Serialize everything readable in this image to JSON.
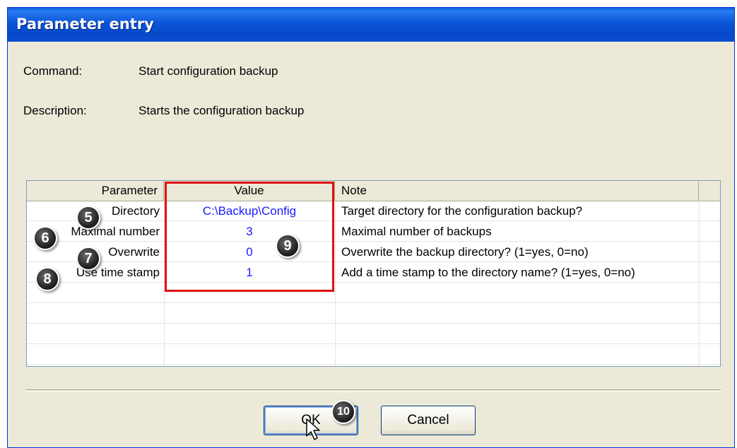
{
  "window": {
    "title": "Parameter entry"
  },
  "command": {
    "label": "Command:",
    "value": "Start configuration backup"
  },
  "description": {
    "label": "Description:",
    "value": "Starts the configuration backup"
  },
  "grid": {
    "headers": {
      "parameter": "Parameter",
      "value": "Value",
      "note": "Note"
    },
    "rows": [
      {
        "badge": "5",
        "parameter": "Directory",
        "value": "C:\\Backup\\Config",
        "note": "Target directory for the configuration backup?"
      },
      {
        "badge": "6",
        "parameter": "Maximal number",
        "value": "3",
        "note": "Maximal number of backups"
      },
      {
        "badge": "7",
        "parameter": "Overwrite",
        "value": "0",
        "note": "Overwrite the backup directory? (1=yes, 0=no)"
      },
      {
        "badge": "8",
        "parameter": "Use time stamp",
        "value": "1",
        "note": "Add a time stamp to the directory name? (1=yes, 0=no)"
      }
    ]
  },
  "badges": {
    "value_column": "9",
    "ok_button": "10"
  },
  "buttons": {
    "ok": "OK",
    "cancel": "Cancel"
  },
  "colors": {
    "title_bar": "#0a54d8",
    "value_text": "#1a1aff",
    "highlight": "#e01010",
    "face": "#ece9d8"
  }
}
